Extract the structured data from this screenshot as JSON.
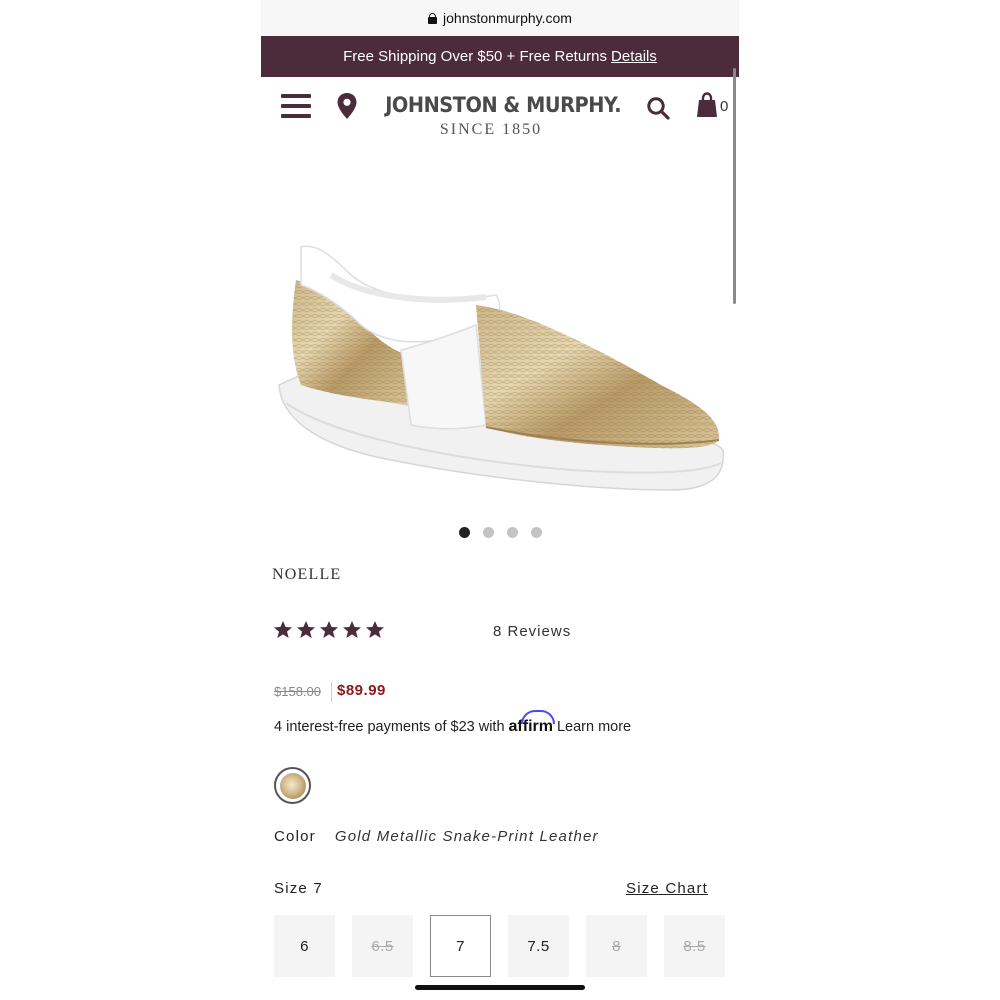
{
  "browser": {
    "url": "johnstonmurphy.com"
  },
  "promo": {
    "text": "Free Shipping Over $50 + Free Returns",
    "details_link": "Details"
  },
  "header": {
    "brand": "JOHNSTON & MURPHY.",
    "since": "SINCE 1850",
    "cart_count": "0",
    "icons": [
      "menu-icon",
      "location-pin-icon",
      "search-icon",
      "shopping-bag-icon"
    ]
  },
  "gallery": {
    "image_count": 4,
    "active_index": 0
  },
  "product": {
    "name": "NOELLE",
    "rating": 5,
    "reviews_label": "8 Reviews",
    "old_price": "$158.00",
    "price": "$89.99",
    "affirm_prefix": "4 interest-free payments of $23 with",
    "affirm_brand": "affirm",
    "affirm_link": "Learn more",
    "color_label": "Color",
    "color_value": "Gold Metallic Snake-Print Leather",
    "size_label": "Size 7",
    "size_chart_link": "Size Chart",
    "sizes": [
      {
        "label": "6",
        "state": "available"
      },
      {
        "label": "6.5",
        "state": "unavailable"
      },
      {
        "label": "7",
        "state": "selected"
      },
      {
        "label": "7.5",
        "state": "available"
      },
      {
        "label": "8",
        "state": "unavailable"
      },
      {
        "label": "8.5",
        "state": "unavailable"
      }
    ]
  },
  "colors": {
    "brand_plum": "#4c2b3a",
    "sale_red": "#8b1a1a"
  }
}
